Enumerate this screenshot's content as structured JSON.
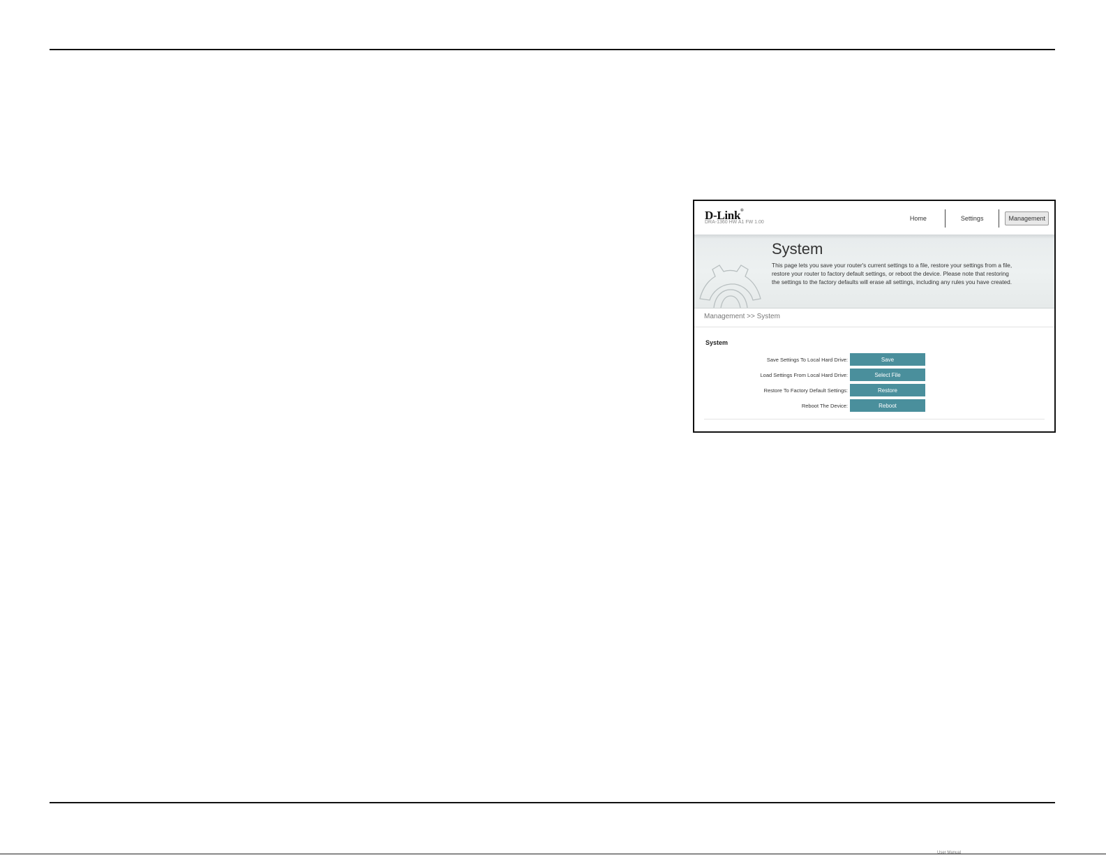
{
  "header": {
    "brand": "D-Link",
    "brand_mark": "®",
    "model_info": "DRA-1360   HW A1   FW 1.00",
    "nav": [
      {
        "label": "Home"
      },
      {
        "label": "Settings"
      },
      {
        "label": "Management"
      }
    ]
  },
  "banner": {
    "title": "System",
    "description": "This page lets you save your router's current settings to a file, restore your settings from a file, restore your router to factory default settings, or reboot the device. Please note that restoring the settings to the factory defaults will erase all settings, including any rules you have created."
  },
  "breadcrumb": "Management >> System",
  "section": {
    "title": "System",
    "rows": [
      {
        "label": "Save Settings To Local Hard Drive:",
        "button": "Save"
      },
      {
        "label": "Load Settings From Local Hard Drive:",
        "button": "Select File"
      },
      {
        "label": "Restore To Factory Default Settings:",
        "button": "Restore"
      },
      {
        "label": "Reboot The Device:",
        "button": "Reboot"
      }
    ]
  },
  "footer": {
    "page_label": "User Manual"
  },
  "colors": {
    "button_bg": "#4a8f9c",
    "button_text": "#ffffff"
  }
}
